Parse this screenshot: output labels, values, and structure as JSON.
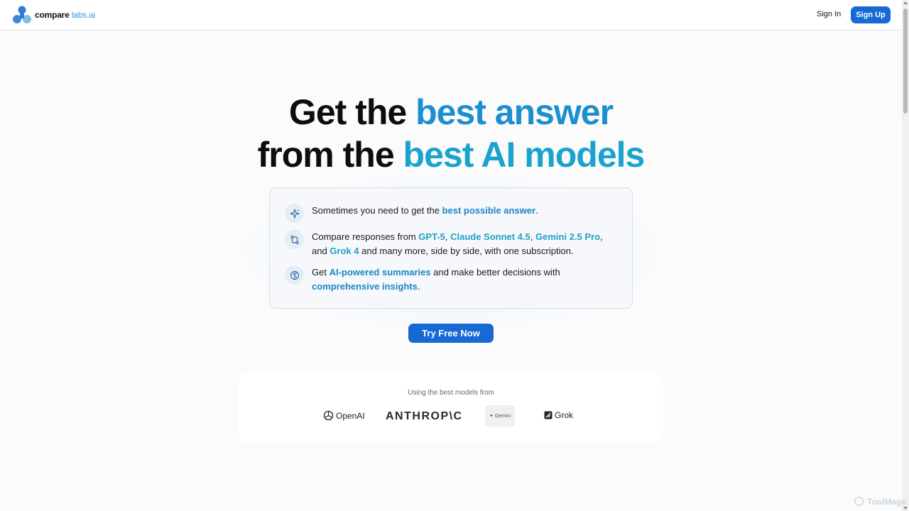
{
  "header": {
    "logo_part1": "compare",
    "logo_part2": "labs.ai",
    "sign_in": "Sign In",
    "sign_up": "Sign Up"
  },
  "hero": {
    "line1_plain": "Get the ",
    "line1_highlight": "best answer",
    "line2_plain": "from the ",
    "line2_highlight": "best AI models"
  },
  "features": [
    {
      "icon": "sparkle-icon",
      "text_a": "Sometimes you need to get the ",
      "hl_a": "best possible answer",
      "text_b": "."
    },
    {
      "icon": "compare-arrows-icon",
      "text_a": "Compare responses from ",
      "m1": "GPT-5",
      "sep1": ", ",
      "m2": "Claude Sonnet 4.5",
      "sep2": ", ",
      "m3": "Gemini 2.5 Pro",
      "sep3": ", and ",
      "m4": "Grok 4",
      "text_b": " and many more, side by side, with one subscription."
    },
    {
      "icon": "brain-icon",
      "text_a": "Get ",
      "hl_a": "AI-powered summaries",
      "text_b": " and make better decisions with ",
      "hl_b": "comprehensive insights",
      "text_c": "."
    }
  ],
  "cta": "Try Free Now",
  "models": {
    "caption": "Using the best models from",
    "openai": "OpenAI",
    "anthropic": "ANTHROP\\C",
    "gemini": "Gemini",
    "grok": "Grok"
  },
  "watermark": "ToolMage",
  "colors": {
    "brand_blue": "#1769d3",
    "highlight_blue": "#1d8fd0",
    "highlight_teal": "#1aa3cc"
  }
}
